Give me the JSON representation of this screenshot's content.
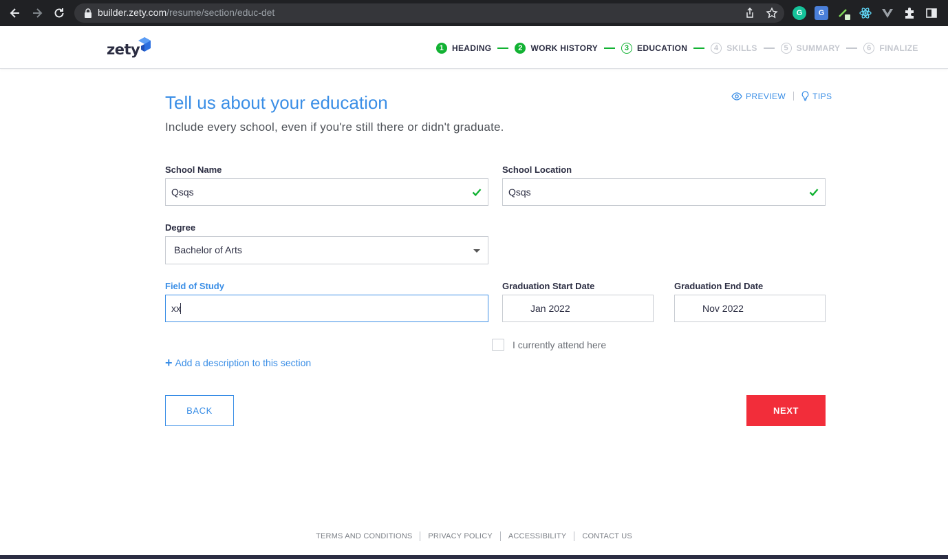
{
  "browser": {
    "url_host": "builder.zety.com",
    "url_path": "/resume/section/educ-det"
  },
  "header": {
    "logo_text": "zety",
    "steps": [
      {
        "num": "1",
        "label": "HEADING",
        "state": "done"
      },
      {
        "num": "2",
        "label": "WORK HISTORY",
        "state": "done"
      },
      {
        "num": "3",
        "label": "EDUCATION",
        "state": "current"
      },
      {
        "num": "4",
        "label": "SKILLS",
        "state": "todo"
      },
      {
        "num": "5",
        "label": "SUMMARY",
        "state": "todo"
      },
      {
        "num": "6",
        "label": "FINALIZE",
        "state": "todo"
      }
    ]
  },
  "main": {
    "title": "Tell us about your education",
    "subtitle": "Include every school, even if you're still there or didn't graduate.",
    "preview_label": "PREVIEW",
    "tips_label": "TIPS"
  },
  "form": {
    "school_name": {
      "label": "School Name",
      "value": "Qsqs"
    },
    "school_location": {
      "label": "School Location",
      "value": "Qsqs"
    },
    "degree": {
      "label": "Degree",
      "value": "Bachelor of Arts"
    },
    "field_of_study": {
      "label": "Field of Study",
      "value": "xx"
    },
    "grad_start": {
      "label": "Graduation Start Date",
      "value": "Jan 2022"
    },
    "grad_end": {
      "label": "Graduation End Date",
      "value": "Nov 2022"
    },
    "attend_label": "I currently attend here",
    "add_description": "Add a description to this section"
  },
  "buttons": {
    "back": "BACK",
    "next": "NEXT"
  },
  "footer": {
    "links": [
      "TERMS AND CONDITIONS",
      "PRIVACY POLICY",
      "ACCESSIBILITY",
      "CONTACT US"
    ]
  },
  "colors": {
    "accent": "#3a8ee6",
    "success": "#12b233",
    "primary_button": "#f22d3a",
    "browser_chrome": "#202124"
  }
}
